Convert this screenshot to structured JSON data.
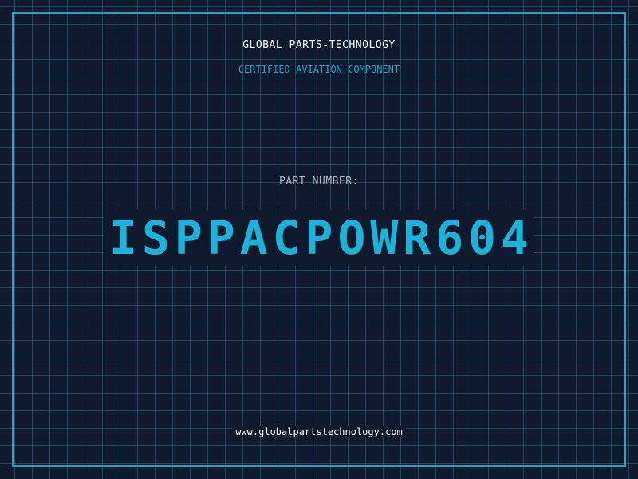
{
  "header": {
    "company_name": "GLOBAL PARTS-TECHNOLOGY",
    "tagline": "CERTIFIED AVIATION COMPONENT"
  },
  "part": {
    "label": "PART NUMBER:",
    "number": "ISPPACPOWR604"
  },
  "footer": {
    "website": "www.globalpartstechnology.com"
  },
  "colors": {
    "background": "#0f1a2e",
    "accent": "#1bb3da",
    "frame": "#1fa3c9",
    "label": "#a7b3c2",
    "text": "#ffffff"
  }
}
